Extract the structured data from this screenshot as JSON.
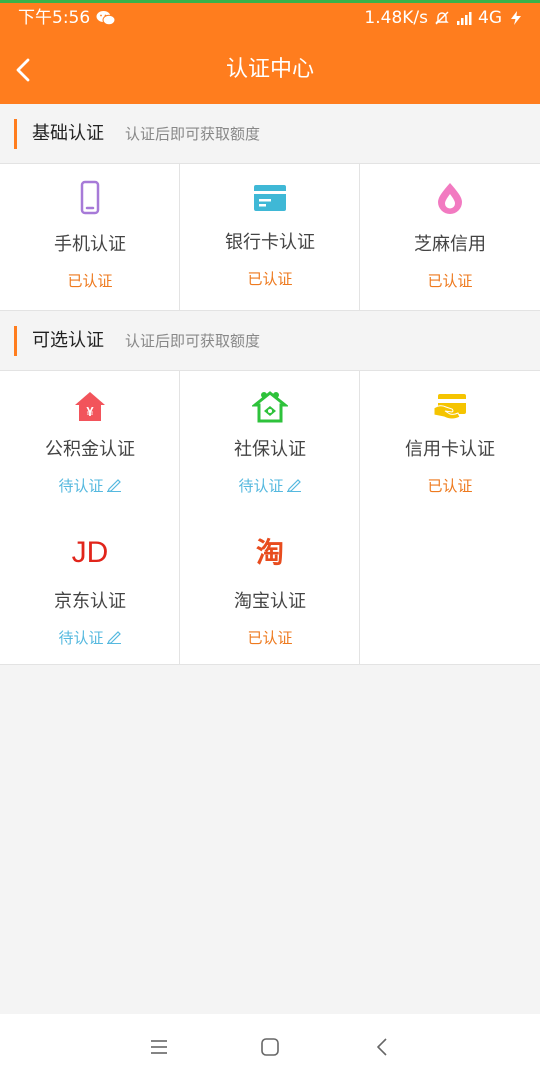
{
  "status_bar": {
    "time": "下午5:56",
    "speed": "1.48K/s",
    "network": "4G"
  },
  "header": {
    "title": "认证中心"
  },
  "sections": [
    {
      "name": "基础认证",
      "hint": "认证后即可获取额度",
      "items": [
        {
          "label": "手机认证",
          "status": "已认证",
          "icon": "phone-icon"
        },
        {
          "label": "银行卡认证",
          "status": "已认证",
          "icon": "bank-card-icon"
        },
        {
          "label": "芝麻信用",
          "status": "已认证",
          "icon": "sesame-credit-icon"
        }
      ]
    },
    {
      "name": "可选认证",
      "hint": "认证后即可获取额度",
      "items": [
        {
          "label": "公积金认证",
          "status": "待认证",
          "icon": "housing-fund-icon"
        },
        {
          "label": "社保认证",
          "status": "待认证",
          "icon": "social-security-icon"
        },
        {
          "label": "信用卡认证",
          "status": "已认证",
          "icon": "credit-card-icon"
        },
        {
          "label": "京东认证",
          "status": "待认证",
          "icon": "jd-logo-icon"
        },
        {
          "label": "淘宝认证",
          "status": "已认证",
          "icon": "taobao-logo-icon"
        }
      ]
    }
  ],
  "colors": {
    "brand": "#ff7d1e",
    "verified": "#ee7a1f",
    "pending": "#56b9df"
  },
  "logos": {
    "jd": "JD",
    "taobao": "淘"
  }
}
